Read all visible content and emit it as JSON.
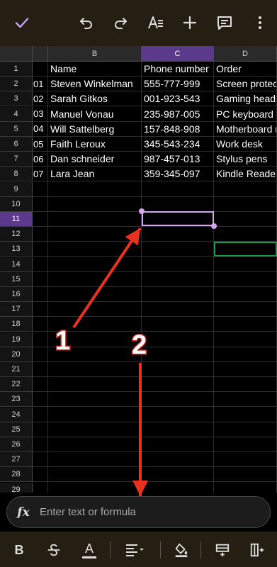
{
  "toolbar": {
    "icons": [
      "check-icon",
      "undo-icon",
      "redo-icon",
      "text-format-icon",
      "add-icon",
      "comment-icon",
      "more-vert-icon"
    ]
  },
  "grid": {
    "columns": [
      "",
      "B",
      "C",
      "D"
    ],
    "selected_column": "C",
    "rows": [
      "1",
      "2",
      "3",
      "4",
      "5",
      "6",
      "7",
      "8",
      "9",
      "10",
      "11",
      "12",
      "13",
      "14",
      "15",
      "16",
      "17",
      "18",
      "19",
      "20",
      "21",
      "22",
      "23",
      "24",
      "25",
      "26",
      "27",
      "28",
      "29"
    ],
    "row_labels_visible": [
      "1",
      "2",
      "3",
      "4",
      "5",
      "6",
      "7",
      "8",
      "9",
      "10",
      "11",
      "12",
      "13",
      "14",
      "15",
      "16",
      "17",
      "18",
      "19",
      "20",
      "21",
      "22",
      "23",
      "24",
      "25",
      "26",
      "27",
      "28",
      "29"
    ],
    "selected_row": "11",
    "data": [
      {
        "a": "",
        "b": "Name",
        "c": "Phone number",
        "d": "Order"
      },
      {
        "a": "01",
        "b": "Steven Winkelman",
        "c": "555-777-999",
        "d": "Screen protec"
      },
      {
        "a": "02",
        "b": "Sarah Gitkos",
        "c": "001-923-543",
        "d": "Gaming heads"
      },
      {
        "a": "03",
        "b": "Manuel Vonau",
        "c": "235-987-005",
        "d": "PC keyboard"
      },
      {
        "a": "04",
        "b": "Will Sattelberg",
        "c": "157-848-908",
        "d": "Motherboard r"
      },
      {
        "a": "05",
        "b": "Faith Leroux",
        "c": "345-543-234",
        "d": "Work desk"
      },
      {
        "a": "06",
        "b": "Dan schneider",
        "c": "987-457-013",
        "d": "Stylus pens"
      },
      {
        "a": "07",
        "b": "Lara Jean",
        "c": "359-345-097",
        "d": "Kindle Reader"
      }
    ]
  },
  "formula_bar": {
    "fx_label": "fx",
    "placeholder": "Enter text or formula",
    "value": ""
  },
  "bottom_toolbar": {
    "icons": [
      "bold-icon",
      "strikethrough-icon",
      "text-color-icon",
      "align-icon",
      "fill-color-icon",
      "insert-row-icon",
      "insert-column-icon"
    ],
    "bold_label": "B",
    "text_color_label": "A"
  },
  "annotations": {
    "label_1": "1",
    "label_2": "2",
    "arrow_color": "#e8321f"
  },
  "colors": {
    "toolbar_bg": "#241f12",
    "selection": "#d5a6f0",
    "header_selected": "#5b3a8c",
    "active_cell": "#1e9a4a"
  }
}
